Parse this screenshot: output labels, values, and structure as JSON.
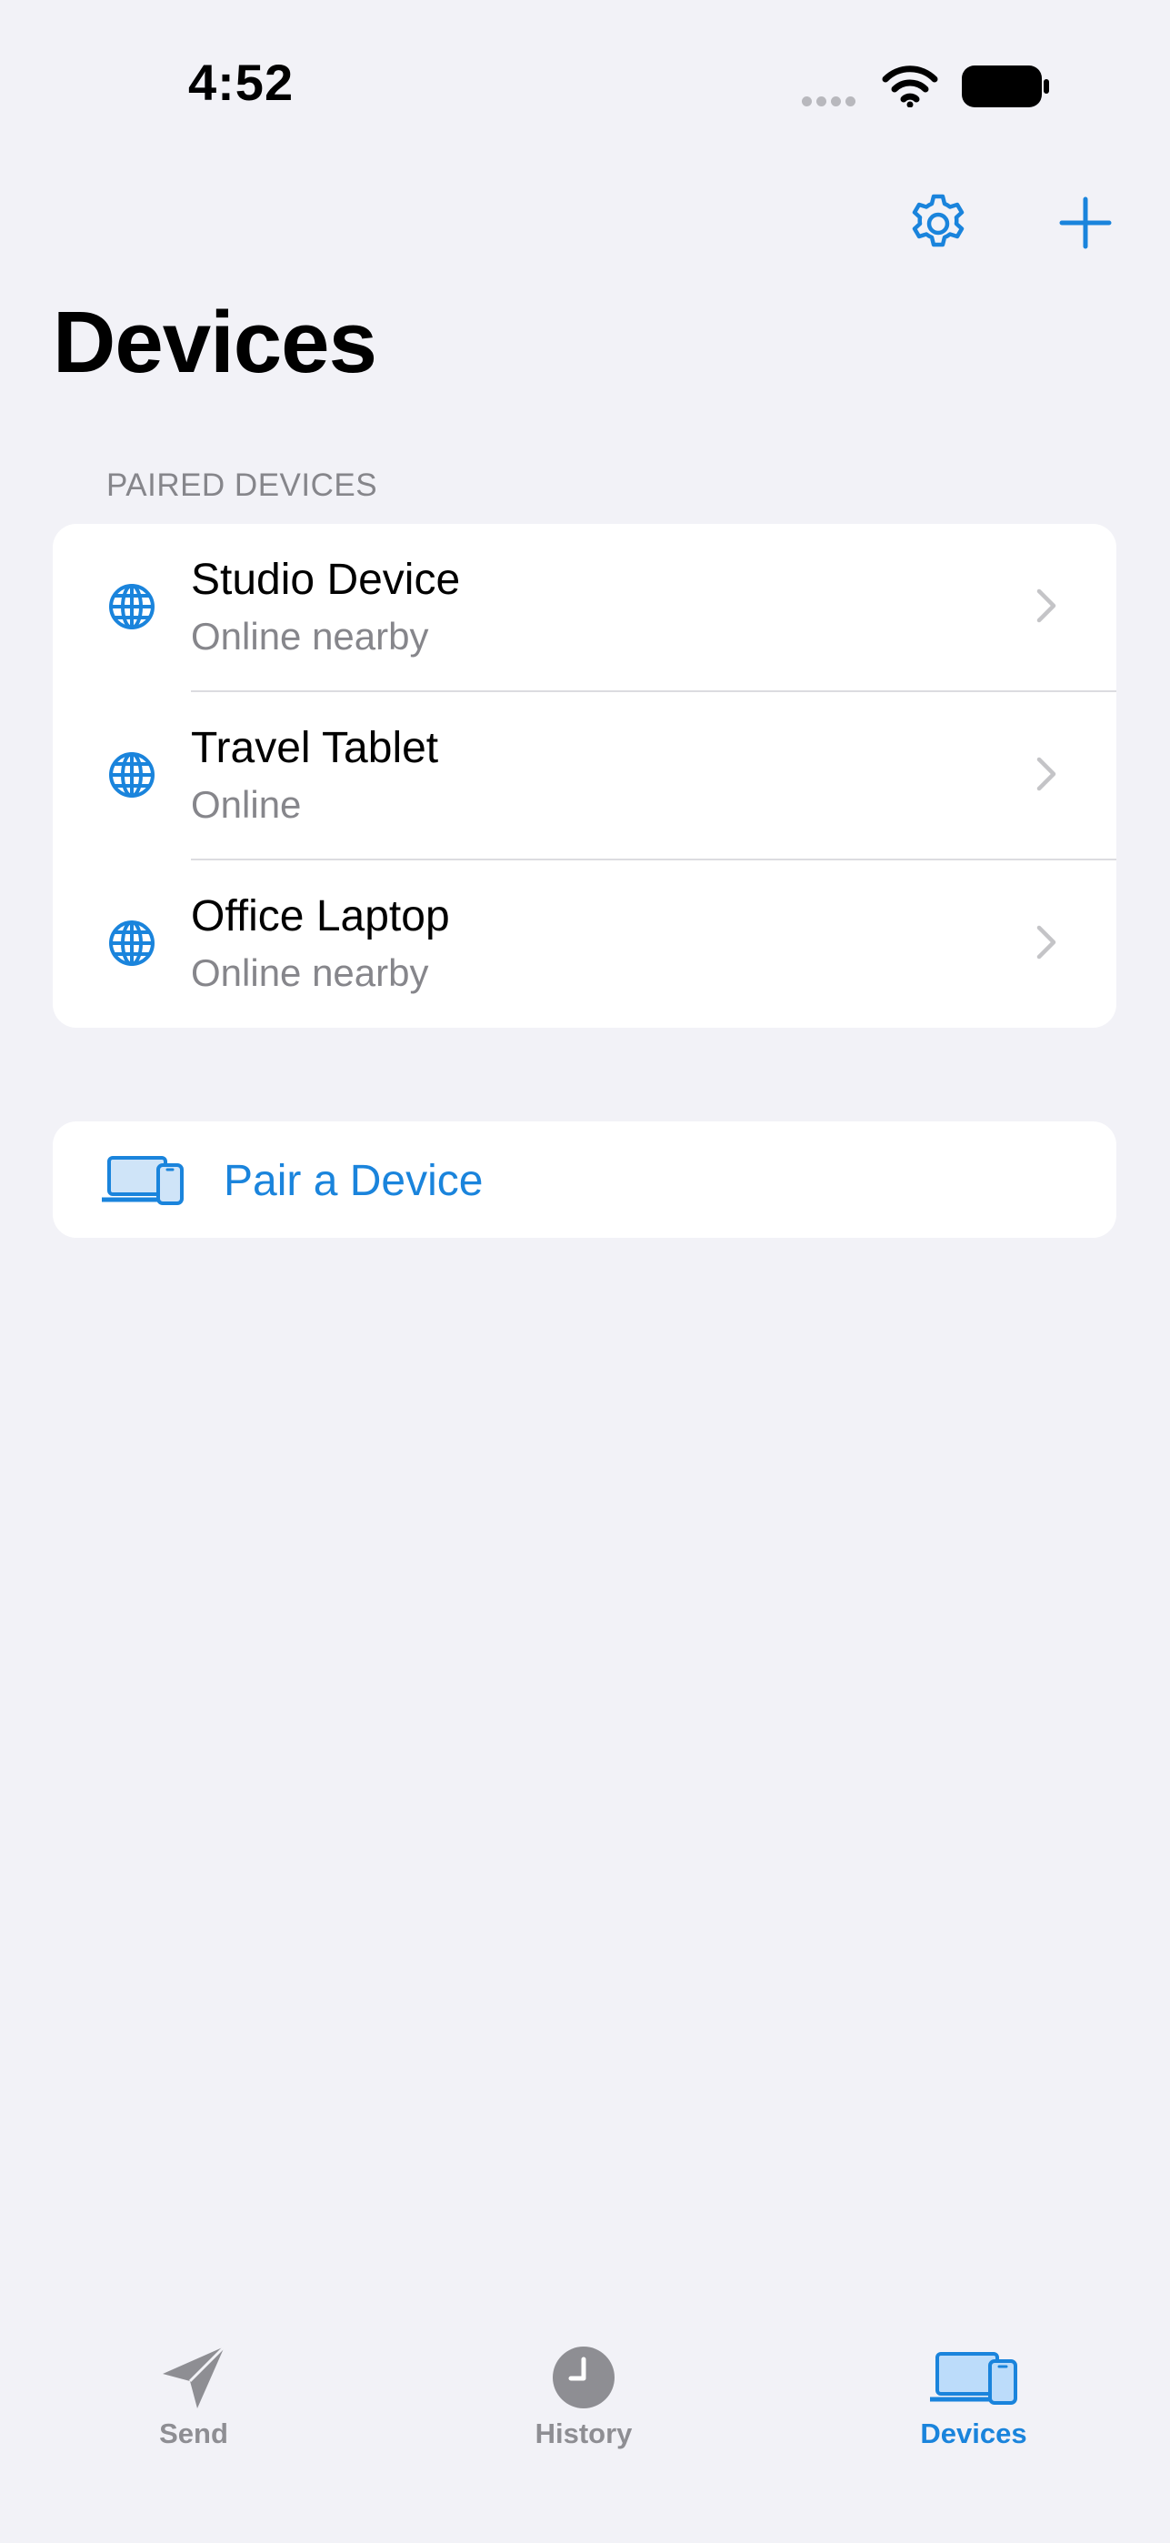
{
  "status_bar": {
    "time": "4:52"
  },
  "header": {
    "title": "Devices"
  },
  "section": {
    "header": "PAIRED DEVICES"
  },
  "devices": [
    {
      "name": "Studio Device",
      "status": "Online nearby"
    },
    {
      "name": "Travel Tablet",
      "status": "Online"
    },
    {
      "name": "Office Laptop",
      "status": "Online nearby"
    }
  ],
  "pair_button": {
    "label": "Pair a Device"
  },
  "tab_bar": {
    "items": [
      {
        "label": "Send",
        "icon": "paper-plane-icon",
        "active": false
      },
      {
        "label": "History",
        "icon": "clock-icon",
        "active": false
      },
      {
        "label": "Devices",
        "icon": "laptop-phone-icon",
        "active": true
      }
    ]
  },
  "colors": {
    "accent": "#1a84dc",
    "background": "#f2f2f7",
    "secondary_text": "#86868b"
  }
}
